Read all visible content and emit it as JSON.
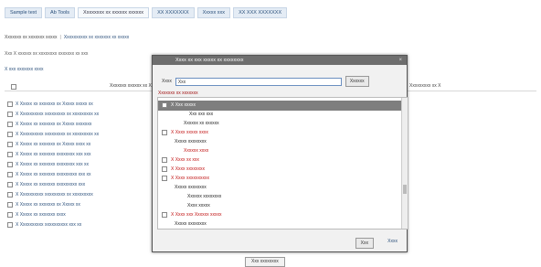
{
  "tabs": [
    "Sample text",
    "Ab Tools",
    "Xxxxxxxx xx xxxxxx xxxxxx",
    "XX XXXXXXX",
    "Xxxxx xxx",
    "XX XXX XXXXXXX"
  ],
  "toolbar": {
    "left": "Xxxxxxx xx xxxxxxx xxxxx",
    "right": "Xxxxxxxxxx xx xxxxxxx xx xxxxx"
  },
  "info_line": "Xxx X xxxxxx xx xxxxxxxx xxxxxxx xx xxx",
  "section_link": "X xxx xxxxxxx xxxx",
  "column_header": "Xxxxxxx xxxxxx xx X",
  "right_header": "Xxxxxxxxx xx X",
  "list_rows": [
    "X Xxxxx xx xxxxxxx xx Xxxxx xxxxx xx",
    "X Xxxxxxxxxx xxxxxxxxx xx xxxxxxxxx xx",
    "X Xxxxx xx xxxxxxx xx Xxxxx xxxxxxx",
    "X Xxxxxxxxxx xxxxxxxxx xx xxxxxxxxx xx",
    "X Xxxxx xx xxxxxxx xx Xxxxx xxxx xx",
    "X Xxxxx xx xxxxxxx xxxxxxxx xxx xxx",
    "X Xxxxx xx xxxxxxx xxxxxxxx xxx xx",
    "X Xxxxx xx xxxxxxx xxxxxxxxx xxx xx",
    "X Xxxxx xx xxxxxxx xxxxxxxxx xxx",
    "X Xxxxxxxxxx xxxxxxxxx xx xxxxxxxxx",
    "X Xxxxx xx xxxxxxx xx Xxxxx xx",
    "X Xxxxx xx xxxxxxx xxxx",
    "X Xxxxxxxxxx xxxxxxxxxx xxx xx"
  ],
  "modal": {
    "title": "Xxxx xx xxx xxxxx xx xxxxxxxx",
    "close": "×",
    "search_label": "Xxxx",
    "search_value": "Xxx",
    "search_button": "Xxxxxx",
    "results_label": "Xxxxxxx xx xxxxxxx",
    "results": [
      {
        "text": "X Xxx xxxxx",
        "color": "#ffffff",
        "indent": 0,
        "cb": true
      },
      {
        "text": "Xxx xxx xxx",
        "color": "#1a1a1a",
        "indent": 30,
        "cb": false
      },
      {
        "text": "Xxxxxx xx xxxxxx",
        "color": "#1a1a1a",
        "indent": 24,
        "cb": false
      },
      {
        "text": "X Xxxx xxxxx xxxx",
        "color": "#c01010",
        "indent": 0,
        "cb": true
      },
      {
        "text": "Xxxxx xxxxxxxx",
        "color": "#1a1a1a",
        "indent": 14,
        "cb": false
      },
      {
        "text": "Xxxxxx xxxx",
        "color": "#c01010",
        "indent": 24,
        "cb": false
      },
      {
        "text": "X Xxxx xx xxx",
        "color": "#c01010",
        "indent": 0,
        "cb": true
      },
      {
        "text": "X Xxxx xxxxxxxx",
        "color": "#c01010",
        "indent": 0,
        "cb": true
      },
      {
        "text": "X Xxxx xxxxxxxxxx",
        "color": "#c01010",
        "indent": 0,
        "cb": true
      },
      {
        "text": "Xxxxx xxxxxxxx",
        "color": "#1a1a1a",
        "indent": 14,
        "cb": false
      },
      {
        "text": "Xxxxxx xxxxxxxx",
        "color": "#1a1a1a",
        "indent": 28,
        "cb": false
      },
      {
        "text": "Xxxx xxxxx",
        "color": "#1a1a1a",
        "indent": 28,
        "cb": false
      },
      {
        "text": "X Xxxx xxx Xxxxxx xxxxx",
        "color": "#c01010",
        "indent": 0,
        "cb": true
      },
      {
        "text": "Xxxxx xxxxxxxx",
        "color": "#1a1a1a",
        "indent": 14,
        "cb": false
      }
    ],
    "close_button": "Xxx",
    "help_link": "Xxxx"
  },
  "bottom_button": "Xxx xxxxxxxx"
}
